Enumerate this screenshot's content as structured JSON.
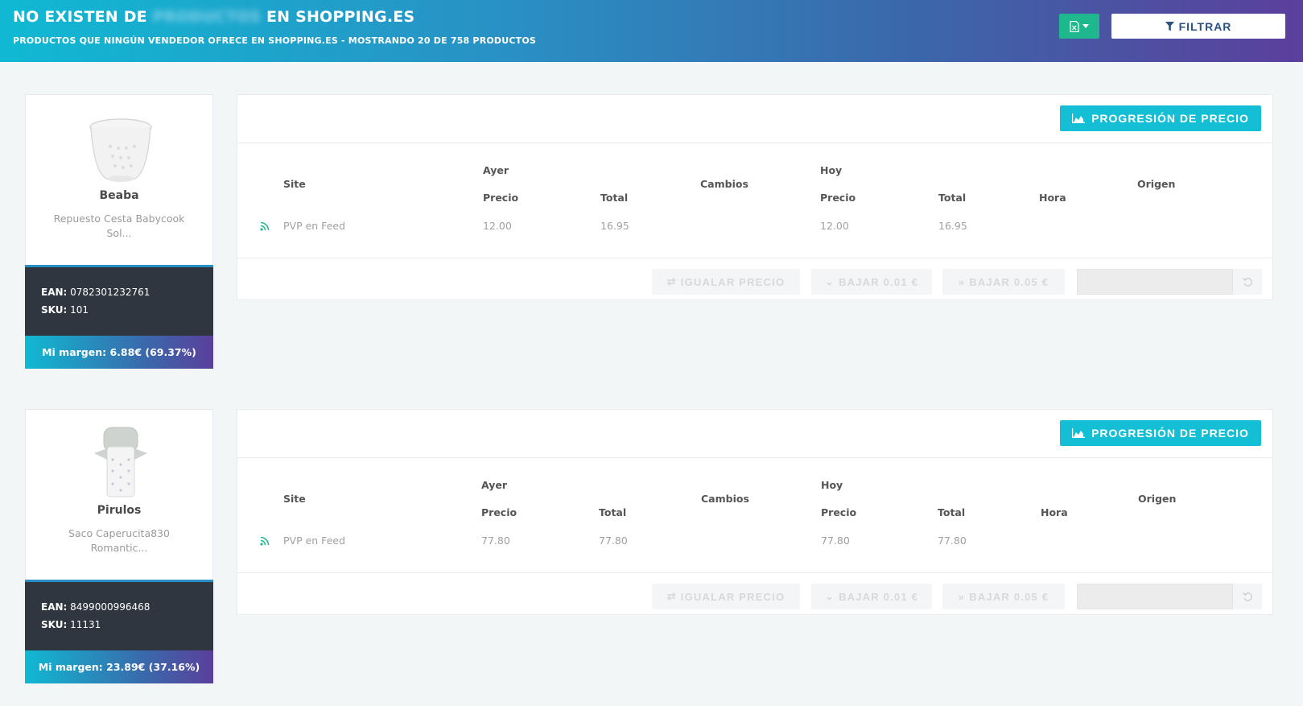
{
  "header": {
    "title_prefix": "NO EXISTEN DE",
    "title_blurred": "PRODUCTOS",
    "title_suffix": "EN SHOPPING.ES",
    "subtitle": "PRODUCTOS QUE NINGÚN VENDEDOR OFRECE EN SHOPPING.ES - MOSTRANDO 20 DE 758 PRODUCTOS",
    "filter_label": "FILTRAR"
  },
  "table_headers": {
    "site": "Site",
    "ayer": "Ayer",
    "hoy": "Hoy",
    "precio": "Precio",
    "total": "Total",
    "cambios": "Cambios",
    "hora": "Hora",
    "origen": "Origen"
  },
  "actions": {
    "progresion": "PROGRESIÓN DE PRECIO",
    "igualar": "IGUALAR PRECIO",
    "bajar_001": "BAJAR 0.01 €",
    "bajar_005": "BAJAR 0.05 €"
  },
  "labels": {
    "ean": "EAN:",
    "sku": "SKU:"
  },
  "products": [
    {
      "brand": "Beaba",
      "name_line1": "Repuesto Cesta Babycook",
      "name_line2": "Sol...",
      "ean": "0782301232761",
      "sku": "101",
      "margin": "Mi margen: 6.88€ (69.37%)",
      "row": {
        "site": "PVP en Feed",
        "ayer_precio": "12.00",
        "ayer_total": "16.95",
        "hoy_precio": "12.00",
        "hoy_total": "16.95"
      }
    },
    {
      "brand": "Pirulos",
      "name_line1": "Saco Caperucita830",
      "name_line2": "Romantic...",
      "ean": "8499000996468",
      "sku": "11131",
      "margin": "Mi margen: 23.89€ (37.16%)",
      "row": {
        "site": "PVP en Feed",
        "ayer_precio": "77.80",
        "ayer_total": "77.80",
        "hoy_precio": "77.80",
        "hoy_total": "77.80"
      }
    }
  ],
  "colors": {
    "accent": "#14bfd6",
    "excel": "#1fb88e",
    "dark_panel": "#2f3640",
    "feed_icon": "#1fb88e"
  },
  "icons": {
    "excel": "file-excel-icon",
    "filter": "filter-icon",
    "chart": "area-chart-icon",
    "feed": "rss-feed-icon",
    "reset": "undo-icon"
  }
}
